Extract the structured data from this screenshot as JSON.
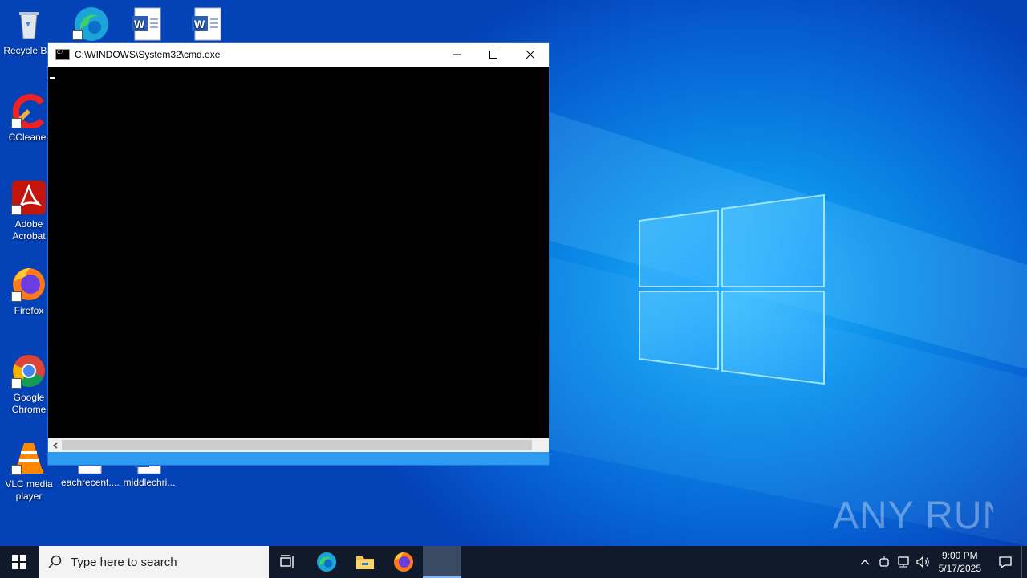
{
  "desktop_icons": [
    {
      "label": "Recycle Bin",
      "icon": "recycle-bin-icon"
    },
    {
      "label": "CCleaner",
      "icon": "ccleaner-icon"
    },
    {
      "label": "Adobe Acrobat",
      "icon": "adobe-acrobat-icon"
    },
    {
      "label": "Firefox",
      "icon": "firefox-icon"
    },
    {
      "label": "Google Chrome",
      "icon": "google-chrome-icon"
    },
    {
      "label": "VLC media player",
      "icon": "vlc-icon"
    },
    {
      "label": "eachrecent....",
      "icon": "image-file-icon"
    },
    {
      "label": "middlechri...",
      "icon": "word-document-icon"
    }
  ],
  "cmd_window": {
    "title": "C:\\WINDOWS\\System32\\cmd.exe",
    "minimize_icon": "minimize-icon",
    "maximize_icon": "maximize-icon",
    "close_icon": "close-icon"
  },
  "watermark": "ANY RUN",
  "taskbar": {
    "search_placeholder": "Type here to search",
    "clock_time": "9:00 PM",
    "clock_date": "5/17/2025"
  },
  "colors": {
    "desktop_blue": "#0b8fea",
    "taskbar": "#101a2a",
    "console_bg": "#000000"
  }
}
